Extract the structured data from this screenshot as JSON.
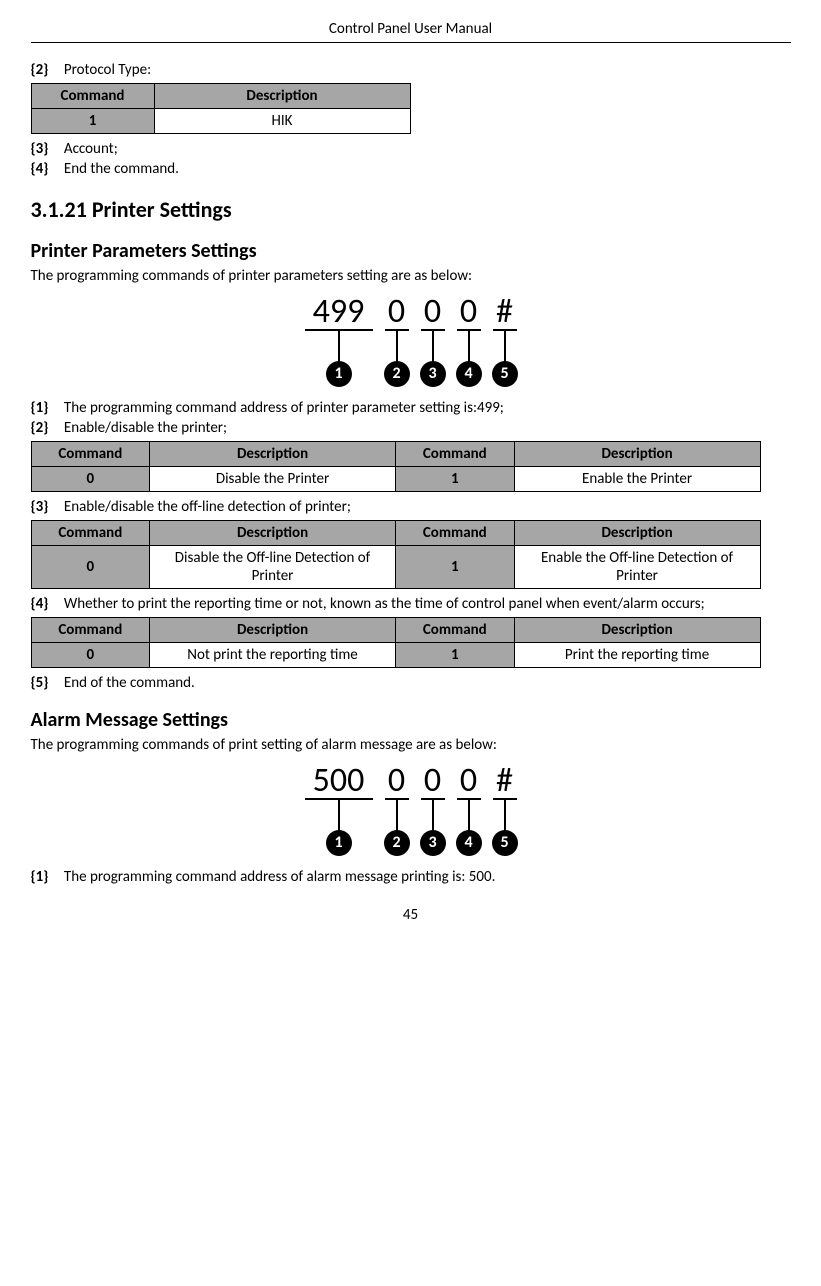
{
  "header": {
    "title": "Control Panel User Manual"
  },
  "footer": {
    "page": "45"
  },
  "top_items": {
    "i2": {
      "tag": "{2}",
      "text": "Protocol Type:"
    },
    "i3": {
      "tag": "{3}",
      "text": "Account;"
    },
    "i4": {
      "tag": "{4}",
      "text": "End the command."
    }
  },
  "protocol_table": {
    "h1": "Command",
    "h2": "Description",
    "r1c1": "1",
    "r1c2": "HIK"
  },
  "section_title": "3.1.21 Printer Settings",
  "sub1_title": "Printer Parameters Settings",
  "sub1_intro": "The programming commands of printer parameters setting are as below:",
  "diagram1": {
    "p1": "499",
    "p2": "0",
    "p3": "0",
    "p4": "0",
    "p5": "#",
    "b1": "1",
    "b2": "2",
    "b3": "3",
    "b4": "4",
    "b5": "5"
  },
  "printer_items": {
    "i1": {
      "tag": "{1}",
      "text": "The programming command address of printer parameter setting is:499;"
    },
    "i2": {
      "tag": "{2}",
      "text": "Enable/disable the printer;"
    },
    "i3": {
      "tag": "{3}",
      "text": "Enable/disable the off-line detection of printer;"
    },
    "i4": {
      "tag": "{4}",
      "text": "Whether to print the reporting time or not, known as the time of control panel when event/alarm occurs;"
    },
    "i5": {
      "tag": "{5}",
      "text": "End of the command."
    }
  },
  "table_enable": {
    "h1": "Command",
    "h2": "Description",
    "h3": "Command",
    "h4": "Description",
    "r1c1": "0",
    "r1c2": "Disable the Printer",
    "r1c3": "1",
    "r1c4": "Enable the Printer"
  },
  "table_offline": {
    "h1": "Command",
    "h2": "Description",
    "h3": "Command",
    "h4": "Description",
    "r1c1": "0",
    "r1c2": "Disable the Off-line Detection of Printer",
    "r1c3": "1",
    "r1c4": "Enable the Off-line Detection of Printer"
  },
  "table_report": {
    "h1": "Command",
    "h2": "Description",
    "h3": "Command",
    "h4": "Description",
    "r1c1": "0",
    "r1c2": "Not print the reporting time",
    "r1c3": "1",
    "r1c4": "Print the reporting time"
  },
  "sub2_title": "Alarm Message Settings",
  "sub2_intro": "The programming commands of print setting of alarm message are as below:",
  "diagram2": {
    "p1": "500",
    "p2": "0",
    "p3": "0",
    "p4": "0",
    "p5": "#",
    "b1": "1",
    "b2": "2",
    "b3": "3",
    "b4": "4",
    "b5": "5"
  },
  "alarm_items": {
    "i1": {
      "tag": "{1}",
      "text": "The programming command address of alarm message printing is: 500."
    }
  }
}
